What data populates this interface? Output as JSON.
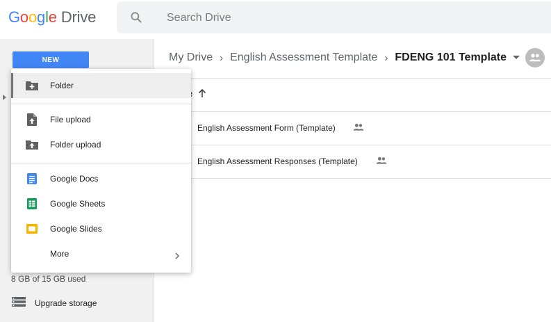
{
  "header": {
    "logo": {
      "google": "Google",
      "product": "Drive"
    },
    "search": {
      "placeholder": "Search Drive",
      "value": ""
    }
  },
  "sidebar": {
    "new_button": "NEW",
    "storage_text": "8 GB of 15 GB used",
    "upgrade_label": "Upgrade storage"
  },
  "breadcrumb": {
    "items": [
      "My Drive",
      "English Assessment Template"
    ],
    "current": "FDENG 101 Template",
    "separator": "›"
  },
  "file_list": {
    "column_header": "e",
    "files": [
      {
        "name": "English Assessment Form (Template)",
        "shared": true
      },
      {
        "name": "English Assessment Responses (Template)",
        "shared": true
      }
    ]
  },
  "new_menu": {
    "items": [
      {
        "label": "Folder",
        "icon": "folder-plus-icon",
        "active": true
      },
      {
        "label": "File upload",
        "icon": "file-upload-icon"
      },
      {
        "label": "Folder upload",
        "icon": "folder-upload-icon"
      },
      {
        "label": "Google Docs",
        "icon": "google-docs-icon",
        "color": "#4285f4"
      },
      {
        "label": "Google Sheets",
        "icon": "google-sheets-icon",
        "color": "#0f9d58"
      },
      {
        "label": "Google Slides",
        "icon": "google-slides-icon",
        "color": "#f4b400"
      },
      {
        "label": "More",
        "icon": "chevron-right-icon"
      }
    ]
  },
  "colors": {
    "accent": "#4285f4",
    "sidebar_bg": "#f1f1f1",
    "search_bg": "#f1f3f4"
  }
}
